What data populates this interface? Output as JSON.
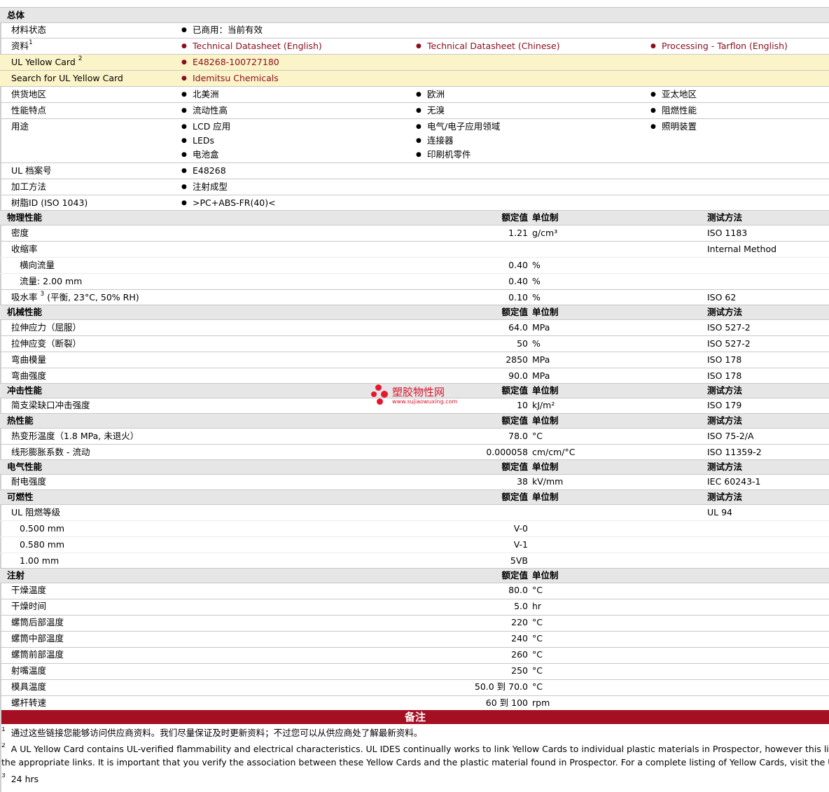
{
  "general": {
    "title": "总体",
    "material_status": {
      "label": "材料状态",
      "value": "已商用：当前有效"
    },
    "sources": {
      "label": "资料",
      "sup": "1",
      "links": [
        "Technical Datasheet (English)",
        "Technical Datasheet (Chinese)",
        "Processing - Tarflon (English)"
      ]
    },
    "ul_yellow_card": {
      "label": "UL Yellow Card",
      "sup": "2",
      "value": "E48268-100727180"
    },
    "search_ul": {
      "label": "Search for UL Yellow Card",
      "value": "Idemitsu Chemicals"
    },
    "supply_region": {
      "label": "供货地区",
      "values": [
        "北美洲",
        "欧洲",
        "亚太地区"
      ]
    },
    "features": {
      "label": "性能特点",
      "values": [
        "流动性高",
        "无溴",
        "阻燃性能"
      ]
    },
    "uses": {
      "label": "用途",
      "col1": [
        "LCD 应用",
        "LEDs",
        "电池盒"
      ],
      "col2": [
        "电气/电子应用领域",
        "连接器",
        "印刷机零件"
      ],
      "col3": [
        "照明装置"
      ]
    },
    "ul_file": {
      "label": "UL 档案号",
      "value": "E48268"
    },
    "processing": {
      "label": "加工方法",
      "value": "注射成型"
    },
    "resin_id": {
      "label": "树脂ID (ISO 1043)",
      "value": ">PC+ABS-FR(40)<"
    }
  },
  "headers": {
    "value": "额定值",
    "unit": "单位制",
    "method": "测试方法"
  },
  "physical": {
    "title": "物理性能",
    "density": {
      "label": "密度",
      "value": "1.21",
      "unit": "g/cm³",
      "method": "ISO 1183"
    },
    "shrinkage": {
      "label": "收缩率",
      "method": "Internal Method"
    },
    "shrink_cross": {
      "label": "横向流量",
      "value": "0.40",
      "unit": "%"
    },
    "shrink_flow": {
      "label": "流量: 2.00 mm",
      "value": "0.40",
      "unit": "%"
    },
    "water": {
      "label": "吸水率",
      "sup": "3",
      "label_suffix": "(平衡, 23°C, 50% RH)",
      "value": "0.10",
      "unit": "%",
      "method": "ISO 62"
    }
  },
  "mechanical": {
    "title": "机械性能",
    "rows": [
      {
        "label": "拉伸应力（屈服）",
        "value": "64.0",
        "unit": "MPa",
        "method": "ISO 527-2"
      },
      {
        "label": "拉伸应变（断裂）",
        "value": "50",
        "unit": "%",
        "method": "ISO 527-2"
      },
      {
        "label": "弯曲模量",
        "value": "2850",
        "unit": "MPa",
        "method": "ISO 178"
      },
      {
        "label": "弯曲强度",
        "value": "90.0",
        "unit": "MPa",
        "method": "ISO 178"
      }
    ]
  },
  "impact": {
    "title": "冲击性能",
    "row": {
      "label": "简支梁缺口冲击强度",
      "value": "10",
      "unit": "kJ/m²",
      "method": "ISO 179"
    }
  },
  "thermal": {
    "title": "热性能",
    "rows": [
      {
        "label": "热变形温度（1.8 MPa, 未退火）",
        "value": "78.0",
        "unit": "°C",
        "method": "ISO 75-2/A"
      },
      {
        "label": "线形膨胀系数 - 流动",
        "value": "0.000058",
        "unit": "cm/cm/°C",
        "method": "ISO 11359-2"
      }
    ]
  },
  "electrical": {
    "title": "电气性能",
    "row": {
      "label": "耐电强度",
      "value": "38",
      "unit": "kV/mm",
      "method": "IEC 60243-1"
    }
  },
  "flammability": {
    "title": "可燃性",
    "ul": {
      "label": "UL 阻燃等级",
      "method": "UL 94"
    },
    "rows": [
      {
        "label": "0.500 mm",
        "value": "V-0"
      },
      {
        "label": "0.580 mm",
        "value": "V-1"
      },
      {
        "label": "1.00 mm",
        "value": "5VB"
      }
    ]
  },
  "injection": {
    "title": "注射",
    "rows": [
      {
        "label": "干燥温度",
        "value": "80.0",
        "unit": "°C"
      },
      {
        "label": "干燥时间",
        "value": "5.0",
        "unit": "hr"
      },
      {
        "label": "螺筒后部温度",
        "value": "220",
        "unit": "°C"
      },
      {
        "label": "螺筒中部温度",
        "value": "240",
        "unit": "°C"
      },
      {
        "label": "螺筒前部温度",
        "value": "260",
        "unit": "°C"
      },
      {
        "label": "射嘴温度",
        "value": "250",
        "unit": "°C"
      },
      {
        "label": "模具温度",
        "value": "50.0 到  70.0",
        "unit": "°C"
      },
      {
        "label": "螺杆转速",
        "value": "60 到  100",
        "unit": "rpm"
      }
    ]
  },
  "notes": {
    "title": "备注",
    "n1": {
      "sup": "1",
      "text": "通过这些链接您能够访问供应商资料。我们尽量保证及时更新资料；不过您可以从供应商处了解最新资料。"
    },
    "n2": {
      "sup": "2",
      "text": "A UL Yellow Card contains UL-verified flammability and electrical characteristics. UL IDES continually works to link Yellow Cards to individual plastic materials in Prospector, however this list may not include all",
      "text2": "the appropriate links. It is important that you verify the association between these Yellow Cards and the plastic material found in Prospector. For a complete listing of Yellow Cards, visit the UL Yellow Card Search."
    },
    "n3": {
      "sup": "3",
      "text": "24 hrs"
    }
  },
  "watermark": {
    "text": "塑胶物性网",
    "url": "www.sujiaowuxing.com"
  }
}
